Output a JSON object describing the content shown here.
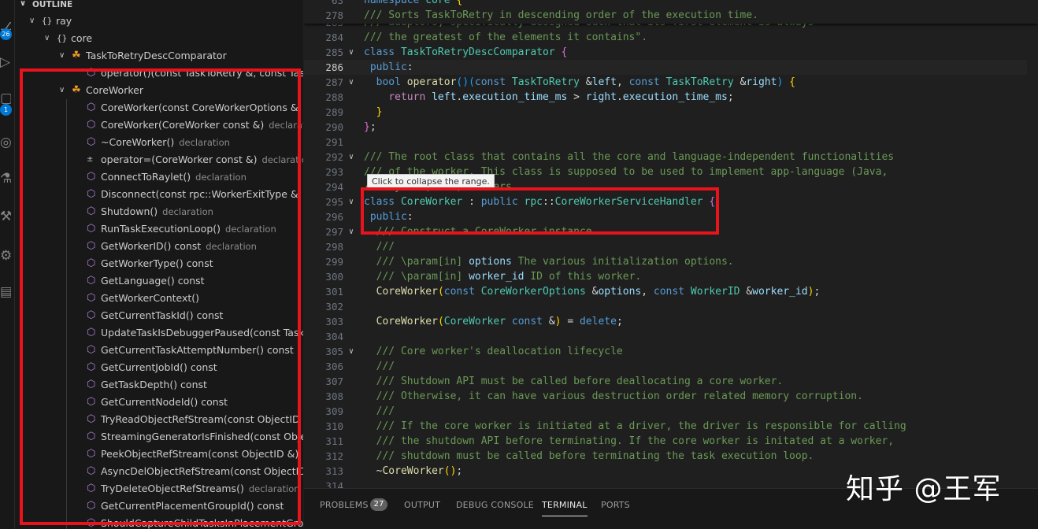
{
  "sidebar": {
    "header": "OUTLINE",
    "activity_badges": [
      "26",
      "1"
    ],
    "tree": [
      {
        "indent": 0,
        "twisty": "v",
        "icon": "namespace",
        "label": "ray",
        "desc": ""
      },
      {
        "indent": 1,
        "twisty": "v",
        "icon": "namespace",
        "label": "core",
        "desc": ""
      },
      {
        "indent": 2,
        "twisty": "v",
        "icon": "class",
        "label": "TaskToRetryDescComparator",
        "desc": ""
      },
      {
        "indent": 3,
        "twisty": "",
        "icon": "method",
        "label": "operator()(const TaskToRetry &, const TaskToRetry &)",
        "desc": ""
      },
      {
        "indent": 2,
        "twisty": "v",
        "icon": "class",
        "label": "CoreWorker",
        "desc": ""
      },
      {
        "indent": 3,
        "twisty": "",
        "icon": "method",
        "label": "CoreWorker(const CoreWorkerOptions &, const WorkerID &)",
        "desc": ""
      },
      {
        "indent": 3,
        "twisty": "",
        "icon": "method",
        "label": "CoreWorker(CoreWorker const &)",
        "desc": "declaration"
      },
      {
        "indent": 3,
        "twisty": "",
        "icon": "method",
        "label": "~CoreWorker()",
        "desc": "declaration"
      },
      {
        "indent": 3,
        "twisty": "",
        "icon": "operator",
        "label": "operator=(CoreWorker const &)",
        "desc": "declaration"
      },
      {
        "indent": 3,
        "twisty": "",
        "icon": "method",
        "label": "ConnectToRaylet()",
        "desc": "declaration"
      },
      {
        "indent": 3,
        "twisty": "",
        "icon": "method",
        "label": "Disconnect(const rpc::WorkerExitType &, const std::string &)",
        "desc": ""
      },
      {
        "indent": 3,
        "twisty": "",
        "icon": "method",
        "label": "Shutdown()",
        "desc": "declaration"
      },
      {
        "indent": 3,
        "twisty": "",
        "icon": "method",
        "label": "RunTaskExecutionLoop()",
        "desc": "declaration"
      },
      {
        "indent": 3,
        "twisty": "",
        "icon": "method",
        "label": "GetWorkerID() const",
        "desc": "declaration"
      },
      {
        "indent": 3,
        "twisty": "",
        "icon": "method",
        "label": "GetWorkerType() const",
        "desc": ""
      },
      {
        "indent": 3,
        "twisty": "",
        "icon": "method",
        "label": "GetLanguage() const",
        "desc": ""
      },
      {
        "indent": 3,
        "twisty": "",
        "icon": "method",
        "label": "GetWorkerContext()",
        "desc": ""
      },
      {
        "indent": 3,
        "twisty": "",
        "icon": "method",
        "label": "GetCurrentTaskId() const",
        "desc": ""
      },
      {
        "indent": 3,
        "twisty": "",
        "icon": "method",
        "label": "UpdateTaskIsDebuggerPaused(const TaskID &, const bool)",
        "desc": ""
      },
      {
        "indent": 3,
        "twisty": "",
        "icon": "method",
        "label": "GetCurrentTaskAttemptNumber() const",
        "desc": ""
      },
      {
        "indent": 3,
        "twisty": "",
        "icon": "method",
        "label": "GetCurrentJobId() const",
        "desc": ""
      },
      {
        "indent": 3,
        "twisty": "",
        "icon": "method",
        "label": "GetTaskDepth() const",
        "desc": ""
      },
      {
        "indent": 3,
        "twisty": "",
        "icon": "method",
        "label": "GetCurrentNodeId() const",
        "desc": ""
      },
      {
        "indent": 3,
        "twisty": "",
        "icon": "method",
        "label": "TryReadObjectRefStream(const ObjectID &, rpc::ObjectReference *)",
        "desc": ""
      },
      {
        "indent": 3,
        "twisty": "",
        "icon": "method",
        "label": "StreamingGeneratorIsFinished(const ObjectID &) const",
        "desc": ""
      },
      {
        "indent": 3,
        "twisty": "",
        "icon": "method",
        "label": "PeekObjectRefStream(const ObjectID &)",
        "desc": "declaration"
      },
      {
        "indent": 3,
        "twisty": "",
        "icon": "method",
        "label": "AsyncDelObjectRefStream(const ObjectID &)",
        "desc": "declaration"
      },
      {
        "indent": 3,
        "twisty": "",
        "icon": "method",
        "label": "TryDeleteObjectRefStreams()",
        "desc": "declaration"
      },
      {
        "indent": 3,
        "twisty": "",
        "icon": "method",
        "label": "GetCurrentPlacementGroupId() const",
        "desc": ""
      },
      {
        "indent": 3,
        "twisty": "",
        "icon": "method",
        "label": "ShouldCaptureChildTasksInPlacementGroup() const",
        "desc": ""
      }
    ]
  },
  "editor": {
    "sticky": [
      {
        "ln": "63",
        "fold": "",
        "html": "<span class=\"c-kw\">namespace</span> <span class=\"c-type\">core</span> <span class=\"c-br\">{</span>"
      },
      {
        "ln": "278",
        "fold": "",
        "html": "<span class=\"c-com\">/// Sorts TaskToRetry in descending order of the execution time.</span>"
      }
    ],
    "lines": [
      {
        "ln": "283",
        "fold": "",
        "html": "<span class=\"c-com\">/// adaptors, specifically designed such that its first element is always</span>"
      },
      {
        "ln": "284",
        "fold": "",
        "html": "<span class=\"c-com\">/// the greatest of the elements it contains\".</span>"
      },
      {
        "ln": "285",
        "fold": "v",
        "html": "<span class=\"c-kw\">class</span> <span class=\"c-type\">TaskToRetryDescComparator</span> <span class=\"c-br2\">{</span>"
      },
      {
        "ln": "286",
        "fold": "",
        "active": true,
        "html": " <span class=\"c-kw\">public</span><span class=\"c-txt\">:</span>"
      },
      {
        "ln": "287",
        "fold": "v",
        "html": "  <span class=\"c-kw\">bool</span> <span class=\"c-fn\">operator</span><span class=\"c-br3\">()</span><span class=\"c-br3\">(</span><span class=\"c-kw\">const</span> <span class=\"c-type\">TaskToRetry</span> <span class=\"c-txt\">&amp;</span><span class=\"c-var\">left</span><span class=\"c-txt\">,</span> <span class=\"c-kw\">const</span> <span class=\"c-type\">TaskToRetry</span> <span class=\"c-txt\">&amp;</span><span class=\"c-var\">right</span><span class=\"c-br3\">)</span> <span class=\"c-br\">{</span>"
      },
      {
        "ln": "288",
        "fold": "",
        "html": "    <span class=\"c-ctl\">return</span> <span class=\"c-var\">left</span><span class=\"c-txt\">.</span><span class=\"c-var\">execution_time_ms</span> <span class=\"c-txt\">&gt;</span> <span class=\"c-var\">right</span><span class=\"c-txt\">.</span><span class=\"c-var\">execution_time_ms</span><span class=\"c-txt\">;</span>"
      },
      {
        "ln": "289",
        "fold": "",
        "html": "  <span class=\"c-br\">}</span>"
      },
      {
        "ln": "290",
        "fold": "",
        "html": "<span class=\"c-br2\">}</span><span class=\"c-txt\">;</span>"
      },
      {
        "ln": "291",
        "fold": "",
        "html": ""
      },
      {
        "ln": "292",
        "fold": "v",
        "html": "<span class=\"c-com\">/// The root class that contains all the core and language-independent functionalities</span>"
      },
      {
        "ln": "293",
        "fold": "",
        "html": "<span class=\"c-com\">/// of the worker. This class is supposed to be used to implement app-language (Java,</span>"
      },
      {
        "ln": "294",
        "fold": "",
        "html": "<span class=\"c-com\">/// Python, etc) workers.</span>"
      },
      {
        "ln": "295",
        "fold": "v",
        "html": "<span class=\"c-kw\">class</span> <span class=\"c-type\">CoreWorker</span> <span class=\"c-txt\">:</span> <span class=\"c-kw\">public</span> <span class=\"c-type\">rpc</span><span class=\"c-txt\">::</span><span class=\"c-type\">CoreWorkerServiceHandler</span> <span class=\"c-br2\">{</span>"
      },
      {
        "ln": "296",
        "fold": "",
        "html": " <span class=\"c-kw\">public</span><span class=\"c-txt\">:</span>"
      },
      {
        "ln": "297",
        "fold": "v",
        "html": "  <span class=\"c-com\">/// Construct a CoreWorker instance.</span>"
      },
      {
        "ln": "298",
        "fold": "",
        "html": "  <span class=\"c-com\">///</span>"
      },
      {
        "ln": "299",
        "fold": "",
        "html": "  <span class=\"c-com\">/// \\param[in] </span><span class=\"c-var\">options</span><span class=\"c-com\"> The various initialization options.</span>"
      },
      {
        "ln": "300",
        "fold": "",
        "html": "  <span class=\"c-com\">/// \\param[in] </span><span class=\"c-var\">worker_id</span><span class=\"c-com\"> ID of this worker.</span>"
      },
      {
        "ln": "301",
        "fold": "",
        "html": "  <span class=\"c-fn\">CoreWorker</span><span class=\"c-br\">(</span><span class=\"c-kw\">const</span> <span class=\"c-type\">CoreWorkerOptions</span> <span class=\"c-txt\">&amp;</span><span class=\"c-var\">options</span><span class=\"c-txt\">,</span> <span class=\"c-kw\">const</span> <span class=\"c-type\">WorkerID</span> <span class=\"c-txt\">&amp;</span><span class=\"c-var\">worker_id</span><span class=\"c-br\">)</span><span class=\"c-txt\">;</span>"
      },
      {
        "ln": "302",
        "fold": "",
        "html": ""
      },
      {
        "ln": "303",
        "fold": "",
        "html": "  <span class=\"c-fn\">CoreWorker</span><span class=\"c-br\">(</span><span class=\"c-type\">CoreWorker</span> <span class=\"c-kw\">const</span> <span class=\"c-txt\">&amp;</span><span class=\"c-br\">)</span> <span class=\"c-txt\">=</span> <span class=\"c-kw\">delete</span><span class=\"c-txt\">;</span>"
      },
      {
        "ln": "304",
        "fold": "",
        "html": ""
      },
      {
        "ln": "305",
        "fold": "v",
        "html": "  <span class=\"c-com\">/// Core worker's deallocation lifecycle</span>"
      },
      {
        "ln": "306",
        "fold": "",
        "html": "  <span class=\"c-com\">///</span>"
      },
      {
        "ln": "307",
        "fold": "",
        "html": "  <span class=\"c-com\">/// Shutdown API must be called before deallocating a core worker.</span>"
      },
      {
        "ln": "308",
        "fold": "",
        "html": "  <span class=\"c-com\">/// Otherwise, it can have various destruction order related memory corruption.</span>"
      },
      {
        "ln": "309",
        "fold": "",
        "html": "  <span class=\"c-com\">///</span>"
      },
      {
        "ln": "310",
        "fold": "",
        "html": "  <span class=\"c-com\">/// If the core worker is initiated at a driver, the driver is responsible for calling</span>"
      },
      {
        "ln": "311",
        "fold": "",
        "html": "  <span class=\"c-com\">/// the shutdown API before terminating. If the core worker is initated at a worker,</span>"
      },
      {
        "ln": "312",
        "fold": "",
        "html": "  <span class=\"c-com\">/// shutdown must be called before terminating the task execution loop.</span>"
      },
      {
        "ln": "313",
        "fold": "",
        "html": "  <span class=\"c-txt\">~</span><span class=\"c-fn\">CoreWorker</span><span class=\"c-br\">()</span><span class=\"c-txt\">;</span>"
      },
      {
        "ln": "314",
        "fold": "",
        "html": ""
      }
    ],
    "tooltip": "Click to collapse the range."
  },
  "panel": {
    "tabs": [
      {
        "label": "PROBLEMS",
        "active": false
      },
      {
        "label": "OUTPUT",
        "active": false
      },
      {
        "label": "DEBUG CONSOLE",
        "active": false
      },
      {
        "label": "TERMINAL",
        "active": true
      },
      {
        "label": "PORTS",
        "active": false
      }
    ],
    "problems_count": "27"
  },
  "watermark": "知乎 @王军",
  "colors": {
    "highlight": "#e8131b",
    "class_icon": "#ee9d28",
    "method_icon": "#b180d7",
    "comment": "#6a9955",
    "keyword": "#569cd6",
    "type": "#4ec9b0"
  }
}
